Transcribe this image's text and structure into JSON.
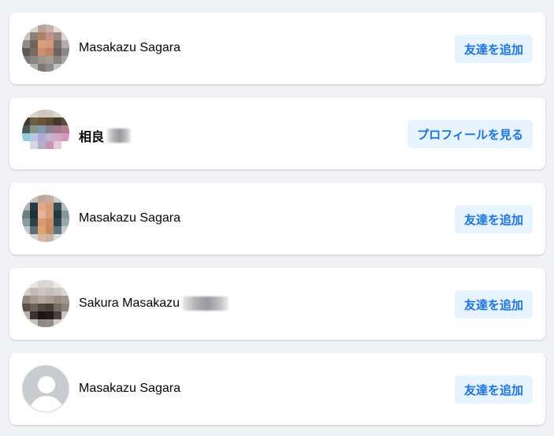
{
  "results": [
    {
      "name": "Masakazu Sagara",
      "action_label": "友達を追加",
      "avatar": "pixelated-photo",
      "has_blur": false
    },
    {
      "name": "相良",
      "action_label": "プロフィールを見る",
      "avatar": "pixelated-photo",
      "has_blur": true
    },
    {
      "name": "Masakazu Sagara",
      "action_label": "友達を追加",
      "avatar": "pixelated-photo",
      "has_blur": false
    },
    {
      "name": "Sakura Masakazu",
      "action_label": "友達を追加",
      "avatar": "pixelated-photo",
      "has_blur": true
    },
    {
      "name": "Masakazu Sagara",
      "action_label": "友達を追加",
      "avatar": "default-avatar-icon",
      "has_blur": false
    }
  ],
  "colors": {
    "page_background": "#f0f2f5",
    "card_background": "#ffffff",
    "button_background": "#e7f3ff",
    "button_text": "#1b74e4",
    "name_text": "#050505"
  }
}
